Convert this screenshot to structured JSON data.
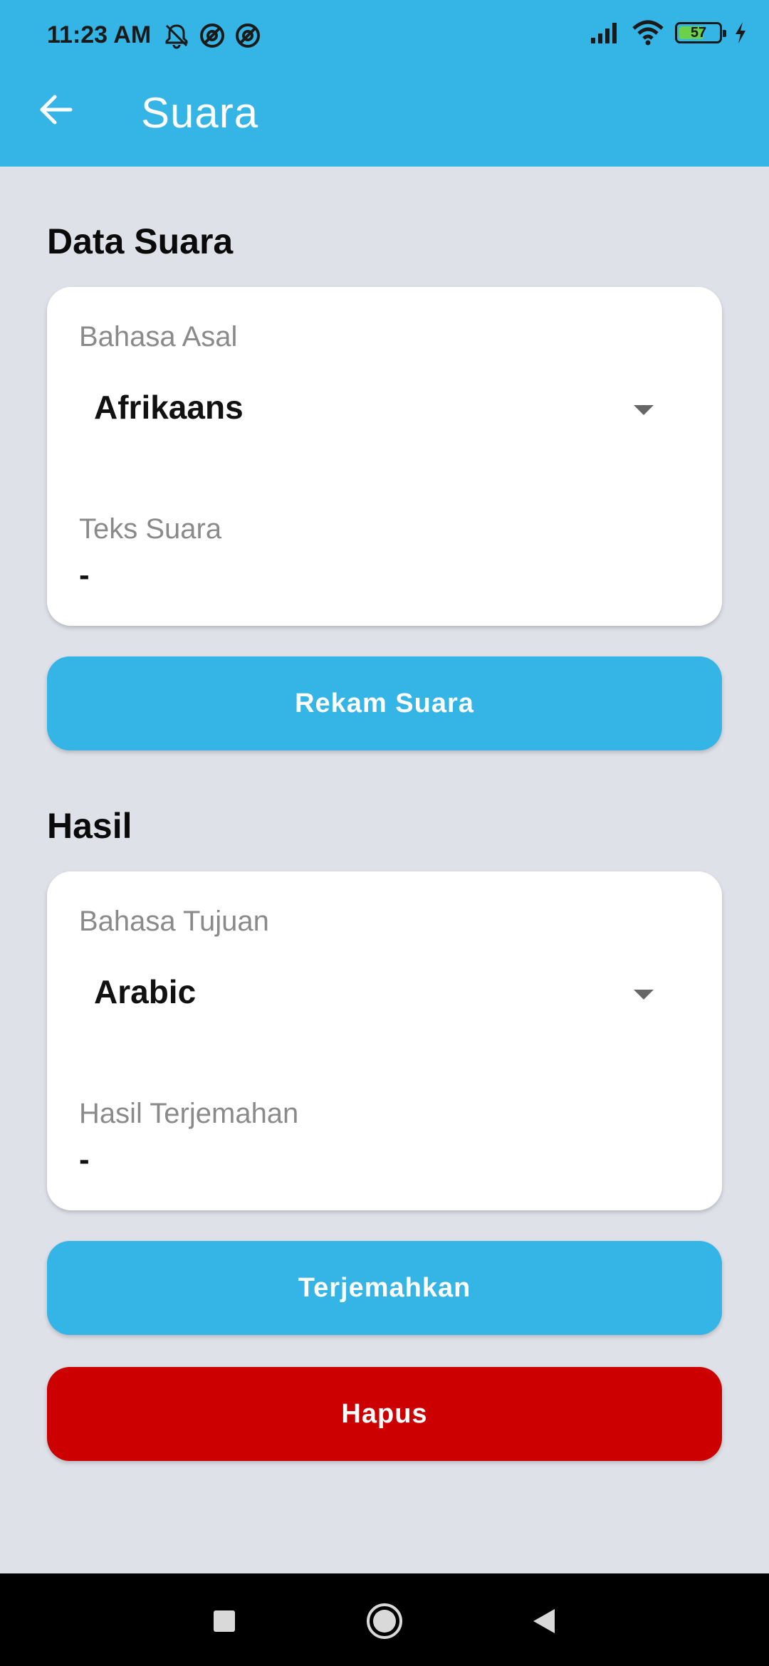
{
  "status_bar": {
    "time": "11:23 AM",
    "battery_level": "57",
    "icons_left": [
      "mute-icon",
      "at-icon",
      "at-icon"
    ],
    "icons_right": [
      "signal-icon",
      "wifi-icon",
      "battery-icon",
      "charging-icon"
    ]
  },
  "app_bar": {
    "title": "Suara",
    "back_icon": "arrow-left-icon",
    "color": "#35b5e5"
  },
  "data_section": {
    "title": "Data Suara",
    "source_language_label": "Bahasa Asal",
    "source_language_value": "Afrikaans",
    "text_label": "Teks Suara",
    "text_value": "-"
  },
  "record_button": {
    "label": "Rekam Suara",
    "color": "#35b5e5"
  },
  "result_section": {
    "title": "Hasil",
    "target_language_label": "Bahasa Tujuan",
    "target_language_value": "Arabic",
    "result_label": "Hasil Terjemahan",
    "result_value": "-"
  },
  "translate_button": {
    "label": "Terjemahkan",
    "color": "#35b5e5"
  },
  "delete_button": {
    "label": "Hapus",
    "color": "#cc0000"
  },
  "nav_bar": {
    "items": [
      "recents-icon",
      "home-icon",
      "back-icon"
    ]
  }
}
